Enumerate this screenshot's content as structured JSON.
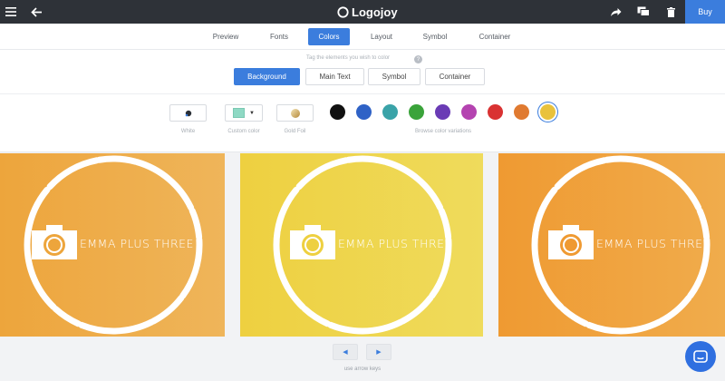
{
  "app": {
    "brand": "Logojoy",
    "buy_label": "Buy"
  },
  "topbar_icons": [
    "menu-icon",
    "back-arrow-icon",
    "share-icon",
    "comment-icon",
    "trash-icon"
  ],
  "tabs": [
    {
      "label": "Preview",
      "active": false
    },
    {
      "label": "Fonts",
      "active": false
    },
    {
      "label": "Colors",
      "active": true
    },
    {
      "label": "Layout",
      "active": false
    },
    {
      "label": "Symbol",
      "active": false
    },
    {
      "label": "Container",
      "active": false
    }
  ],
  "tagging": {
    "hint": "Tag the elements you wish to color",
    "help": "?",
    "buttons": [
      {
        "label": "Background",
        "active": true
      },
      {
        "label": "Main Text",
        "active": false
      },
      {
        "label": "Symbol",
        "active": false
      },
      {
        "label": "Container",
        "active": false
      }
    ]
  },
  "color_options": {
    "white_label": "White",
    "custom_label": "Custom color",
    "custom_swatch": "#8fd9c4",
    "gold_label": "Gold Foil",
    "browse_label": "Browse color variations"
  },
  "swatches": [
    "#111111",
    "#2f62c6",
    "#3aa3a8",
    "#3aa33a",
    "#6a3bb5",
    "#b443b0",
    "#d93232",
    "#e07a30",
    "#e9c23c"
  ],
  "selected_swatch": 8,
  "cards": [
    {
      "name": "EMMA PLUS THREE",
      "bg_from": "#eda53c",
      "bg_to": "#efb55a"
    },
    {
      "name": "EMMA PLUS THREE",
      "bg_from": "#eed040",
      "bg_to": "#efdb5c"
    },
    {
      "name": "EMMA PLUS THREE",
      "bg_from": "#ef9a32",
      "bg_to": "#f0ac4c"
    }
  ],
  "pager": {
    "prev": "◀",
    "next": "▶",
    "hint": "use arrow keys"
  }
}
